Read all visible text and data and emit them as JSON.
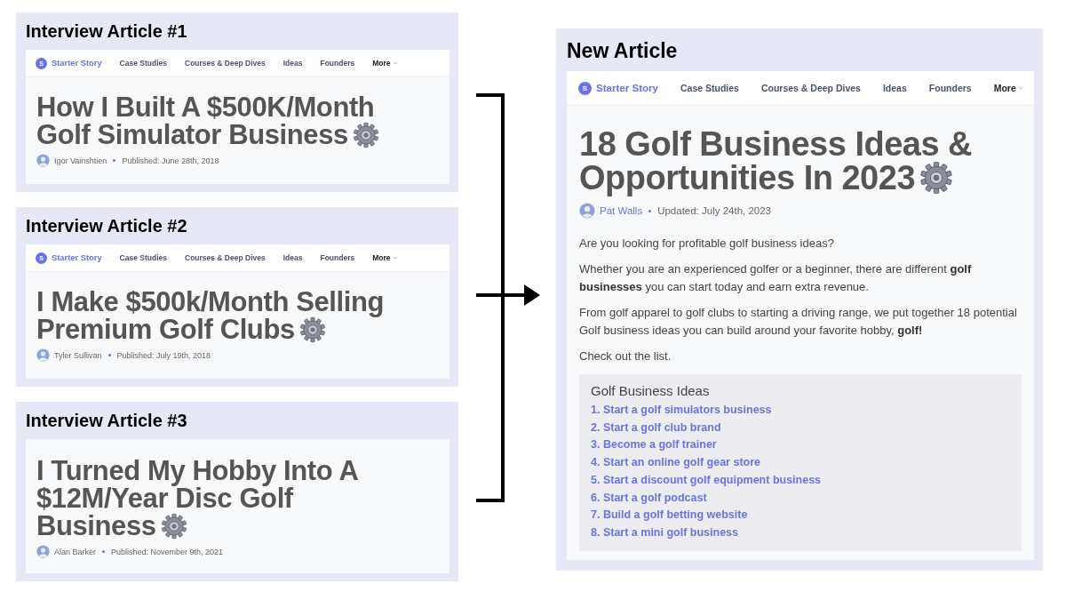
{
  "articles": [
    {
      "heading": "Interview Article #1",
      "nav": {
        "logo": "S",
        "brand": "Starter Story",
        "items": [
          "Case Studies",
          "Courses & Deep Dives",
          "Ideas",
          "Founders"
        ],
        "more": "More"
      },
      "title_lines": [
        "How I Built A $500K/Month",
        "Golf Simulator Business"
      ],
      "author": "Igor Vainshtien",
      "date": "Published: June 28th, 2018"
    },
    {
      "heading": "Interview Article #2",
      "nav": {
        "logo": "S",
        "brand": "Starter Story",
        "items": [
          "Case Studies",
          "Courses & Deep Dives",
          "Ideas",
          "Founders"
        ],
        "more": "More"
      },
      "title_lines": [
        "I Make $500k/Month Selling",
        "Premium Golf Clubs"
      ],
      "author": "Tyler Sullivan",
      "date": "Published: July 19th, 2018"
    },
    {
      "heading": "Interview Article #3",
      "title_lines": [
        "I Turned My Hobby Into A",
        "$12M/Year Disc Golf",
        "Business"
      ],
      "author": "Alan Barker",
      "date": "Published: November 9th, 2021"
    }
  ],
  "new_article": {
    "heading": "New Article",
    "nav": {
      "logo": "S",
      "brand": "Starter Story",
      "items": [
        "Case Studies",
        "Courses & Deep Dives",
        "Ideas",
        "Founders"
      ],
      "more": "More"
    },
    "title_lines": [
      "18 Golf Business Ideas &",
      "Opportunities In 2023"
    ],
    "author": "Pat Walls",
    "date": "Updated: July 24th, 2023",
    "paragraphs": [
      "Are you looking for profitable golf business ideas?",
      "Whether you are an experienced golfer or a beginner, there are different **golf businesses** you can start today and earn extra revenue.",
      "From golf apparel to golf clubs to starting a driving range, we put together 18 potential Golf business ideas you can build around your favorite hobby, **golf!**",
      "Check out the list."
    ],
    "toc": {
      "title": "Golf Business Ideas",
      "items": [
        "1. Start a golf simulators business",
        "2. Start a golf club brand",
        "3. Become a golf trainer",
        "4. Start an online golf gear store",
        "5. Start a discount golf equipment business",
        "6. Start a golf podcast",
        "7. Build a golf betting website",
        "8. Start a mini golf business"
      ]
    }
  }
}
